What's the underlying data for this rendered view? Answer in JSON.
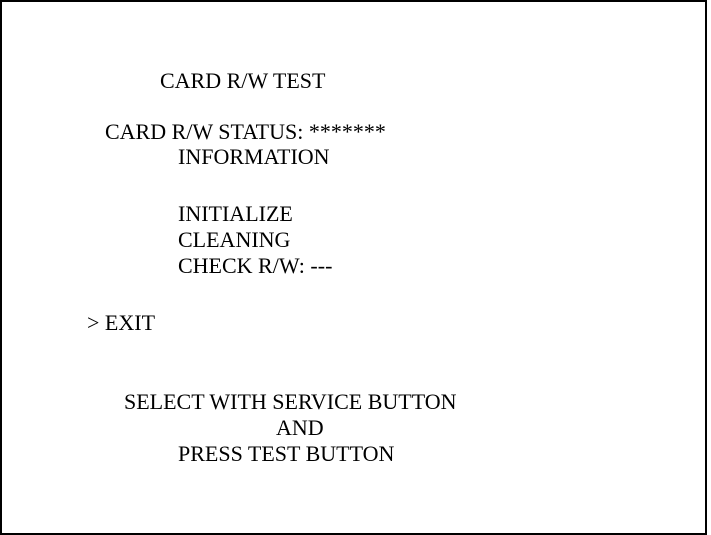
{
  "screen": {
    "title": "CARD R/W TEST",
    "status_label": "CARD R/W STATUS:",
    "status_value": "*******",
    "menu": {
      "information": "INFORMATION",
      "initialize": "INITIALIZE",
      "cleaning": "CLEANING",
      "check_label": "CHECK R/W:",
      "check_value": "---",
      "cursor": ">",
      "exit": "EXIT"
    },
    "instructions": {
      "line1": "SELECT WITH SERVICE BUTTON",
      "line2": "AND",
      "line3": "PRESS TEST BUTTON"
    }
  },
  "colors": {
    "background": "#ffffff",
    "text": "#000000",
    "border": "#000000"
  }
}
